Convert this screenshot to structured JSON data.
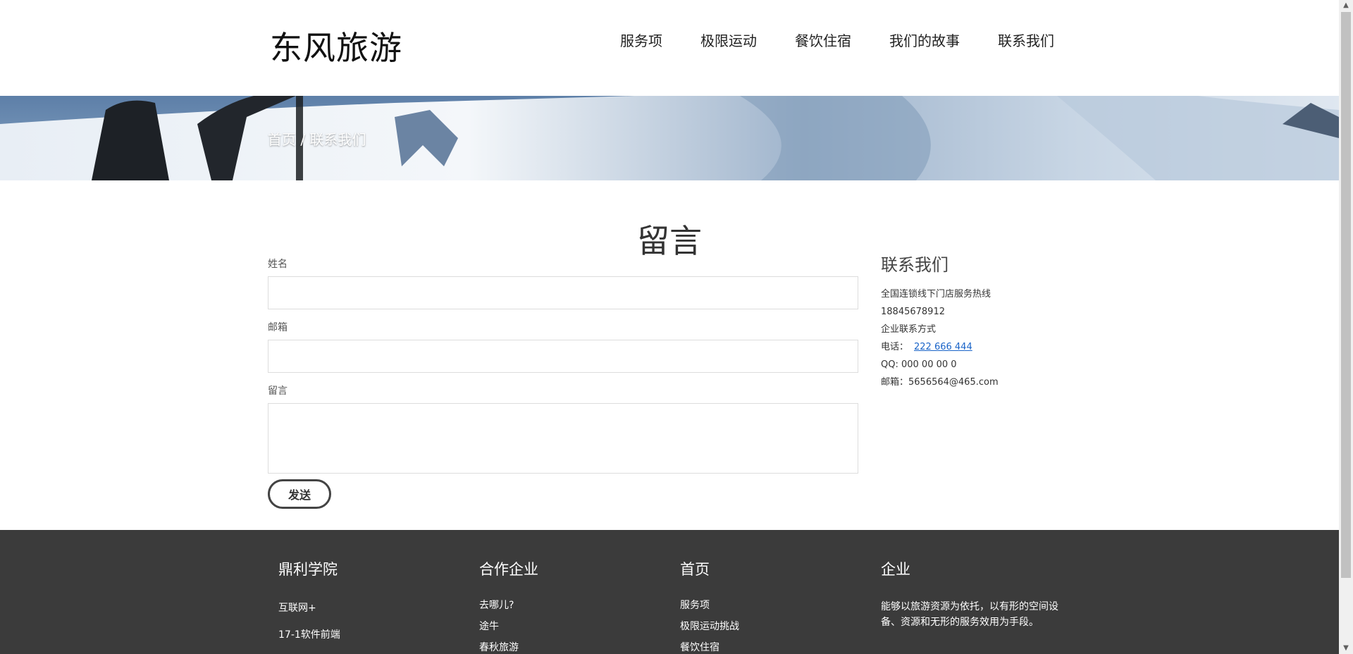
{
  "brand": {
    "logo": "东风旅游"
  },
  "nav": [
    {
      "label": "服务项"
    },
    {
      "label": "极限运动"
    },
    {
      "label": "餐饮住宿"
    },
    {
      "label": "我们的故事"
    },
    {
      "label": "联系我们"
    }
  ],
  "breadcrumb": {
    "text": "首页 / 联系我们"
  },
  "form": {
    "title": "留言",
    "name_label": "姓名",
    "email_label": "邮箱",
    "message_label": "留言",
    "name_value": "",
    "email_value": "",
    "message_value": "",
    "submit_label": "发送"
  },
  "contact": {
    "title": "联系我们",
    "hotline_label": "全国连锁线下门店服务热线",
    "hotline_number": "18845678912",
    "company_label": "企业联系方式",
    "phone_label": "电话：",
    "phone_value": "222 666 444",
    "qq": "QQ: 000 00 00 0",
    "email": "邮箱：5656564@465.com"
  },
  "footer": {
    "col1": {
      "title": "鼎利学院",
      "items": [
        "互联网+",
        "17-1软件前端"
      ]
    },
    "col2": {
      "title": "合作企业",
      "items": [
        "去哪儿?",
        "途牛",
        "春秋旅游"
      ]
    },
    "col3": {
      "title": "首页",
      "items": [
        "服务项",
        "极限运动挑战",
        "餐饮住宿"
      ]
    },
    "col4": {
      "title": "企业",
      "description": "能够以旅游资源为依托，以有形的空间设备、资源和无形的服务效用为手段。"
    }
  },
  "colors": {
    "footer_bg": "#3b3b3b",
    "link": "#1a64c8",
    "text": "#333333"
  },
  "icons": {
    "scroll_up": "caret-up-icon",
    "scroll_down": "caret-down-icon"
  }
}
